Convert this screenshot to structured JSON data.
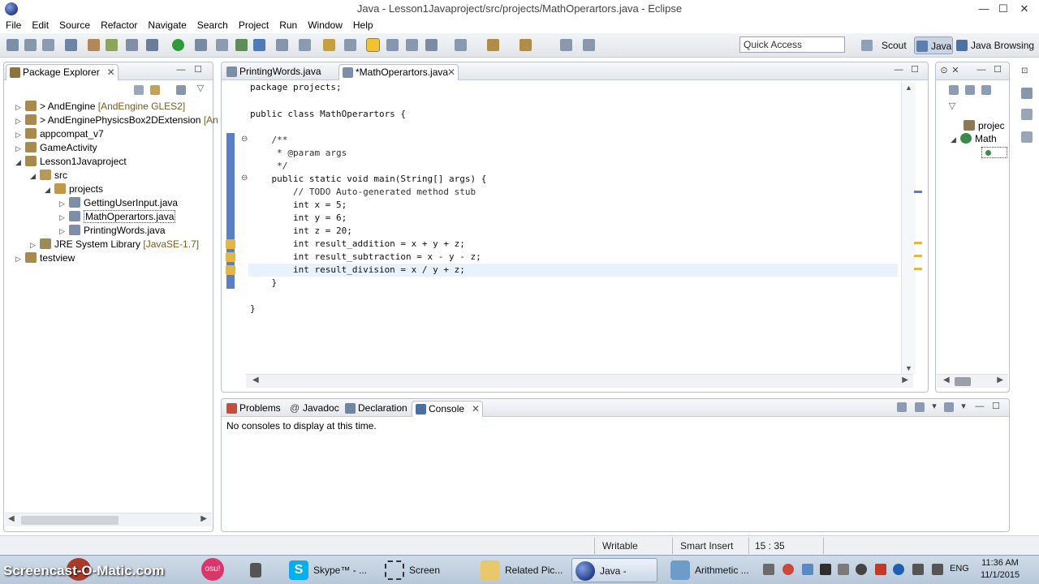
{
  "window": {
    "title": "Java - Lesson1Javaproject/src/projects/MathOperartors.java - Eclipse",
    "min": "—",
    "max": "☐",
    "close": "✕"
  },
  "menu": [
    "File",
    "Edit",
    "Source",
    "Refactor",
    "Navigate",
    "Search",
    "Project",
    "Run",
    "Window",
    "Help"
  ],
  "toolbar": {
    "quick_access": "Quick Access"
  },
  "perspectives": [
    {
      "label": "Scout"
    },
    {
      "label": "Java"
    },
    {
      "label": "Java Browsing"
    }
  ],
  "package_explorer": {
    "title": "Package Explorer",
    "items": [
      {
        "label": "> AndEngine",
        "deco": "[AndEngine GLES2]"
      },
      {
        "label": "> AndEnginePhysicsBox2DExtension",
        "deco": "[An"
      },
      {
        "label": "appcompat_v7",
        "deco": ""
      },
      {
        "label": "GameActivity",
        "deco": ""
      },
      {
        "label": "Lesson1Javaproject",
        "deco": ""
      },
      {
        "label": "src",
        "deco": ""
      },
      {
        "label": "projects",
        "deco": ""
      },
      {
        "label": "GettingUserInput.java",
        "deco": ""
      },
      {
        "label": "MathOperartors.java",
        "deco": ""
      },
      {
        "label": "PrintingWords.java",
        "deco": ""
      },
      {
        "label": "JRE System Library",
        "deco": "[JavaSE-1.7]"
      },
      {
        "label": "testview",
        "deco": ""
      }
    ]
  },
  "editor": {
    "tabs": [
      {
        "label": "PrintingWords.java"
      },
      {
        "label": "*MathOperartors.java"
      }
    ],
    "lines": [
      "package projects;",
      "",
      "public class MathOperartors {",
      "",
      "    /**",
      "     * @param args",
      "     */",
      "    public static void main(String[] args) {",
      "        // TODO Auto-generated method stub",
      "        int x = 5;",
      "        int y = 6;",
      "        int z = 20;",
      "        int result_addition = x + y + z;",
      "        int result_subtraction = x - y - z;",
      "        int result_division = x / y + z;",
      "    }",
      "",
      "}"
    ]
  },
  "outline": {
    "items": [
      {
        "label": "projec"
      },
      {
        "label": "Math"
      }
    ]
  },
  "bottom": {
    "tabs": [
      {
        "label": "Problems"
      },
      {
        "label": "Javadoc"
      },
      {
        "label": "Declaration"
      },
      {
        "label": "Console"
      }
    ],
    "message": "No consoles to display at this time."
  },
  "status": {
    "writable": "Writable",
    "insert": "Smart Insert",
    "position": "15 : 35"
  },
  "taskbar": {
    "watermark": "Screencast-O-Matic.com",
    "items": [
      {
        "label": "Skype™ - ..."
      },
      {
        "label": "Screen Rec..."
      },
      {
        "label": "Related Pic..."
      },
      {
        "label": "Java - Less..."
      },
      {
        "label": "Arithmetic ..."
      }
    ],
    "lang": "ENG",
    "time": "11:36 AM",
    "date": "11/1/2015"
  }
}
